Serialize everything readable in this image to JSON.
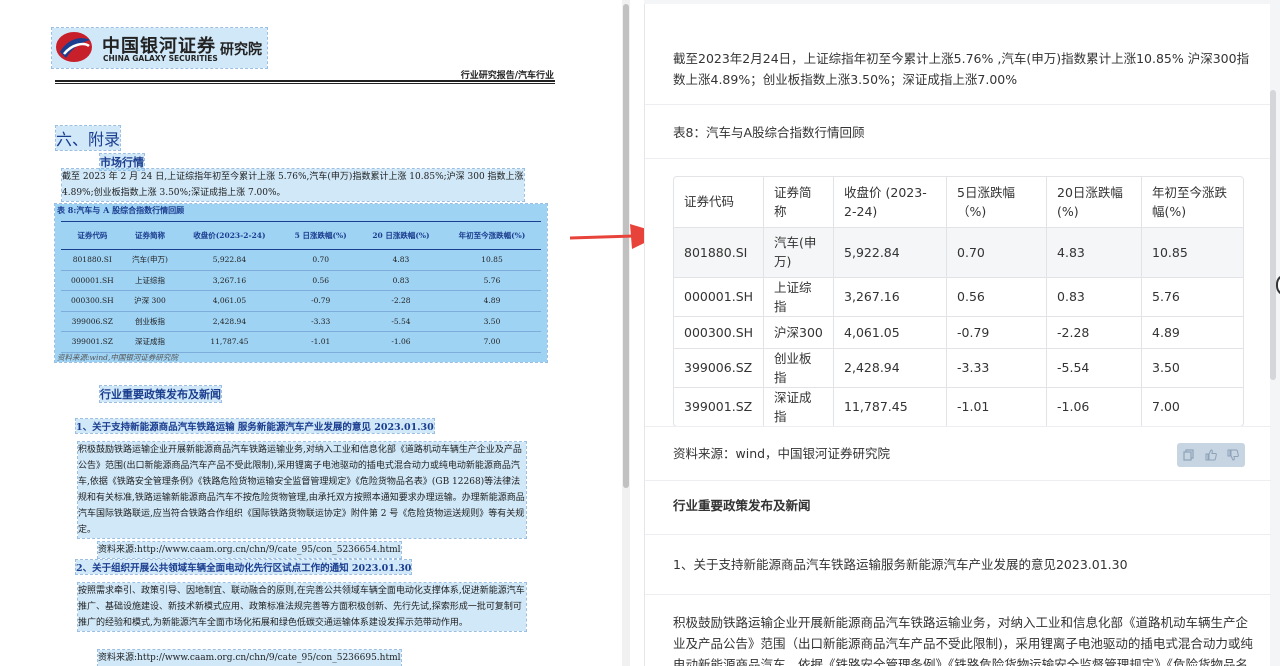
{
  "pdf": {
    "logo_cn": "中国银河证券",
    "logo_en": "CHINA GALAXY SECURITIES",
    "logo_inst": "研究院",
    "header_tag": "行业研究报告/汽车行业",
    "section_title": "六、附录",
    "market_heading": "市场行情",
    "market_paragraph": "截至 2023 年 2 月 24 日,上证综指年初至今累计上涨 5.76%,汽车(申万)指数累计上涨 10.85%;沪深 300 指数上涨 4.89%;创业板指数上涨 3.50%;深证成指上涨 7.00%。",
    "table_caption": "表 8:汽车与 A 股综合指数行情回顾",
    "table_headers": [
      "证券代码",
      "证券简称",
      "收盘价(2023-2-24)",
      "5 日涨跌幅(%)",
      "20 日涨跌幅(%)",
      "年初至今涨跌幅(%)"
    ],
    "table_rows": [
      [
        "801880.SI",
        "汽车(申万)",
        "5,922.84",
        "0.70",
        "4.83",
        "10.85"
      ],
      [
        "000001.SH",
        "上证综指",
        "3,267.16",
        "0.56",
        "0.83",
        "5.76"
      ],
      [
        "000300.SH",
        "沪深 300",
        "4,061.05",
        "-0.79",
        "-2.28",
        "4.89"
      ],
      [
        "399006.SZ",
        "创业板指",
        "2,428.94",
        "-3.33",
        "-5.54",
        "3.50"
      ],
      [
        "399001.SZ",
        "深证成指",
        "11,787.45",
        "-1.01",
        "-1.06",
        "7.00"
      ]
    ],
    "table_source": "资料来源:wind,中国银河证券研究院",
    "policy_heading": "行业重要政策发布及新闻",
    "news1_title": "1、关于支持新能源商品汽车铁路运输 服务新能源汽车产业发展的意见 2023.01.30",
    "news1_body": "积极鼓励铁路运输企业开展新能源商品汽车铁路运输业务,对纳入工业和信息化部《道路机动车辆生产企业及产品公告》范围(出口新能源商品汽车产品不受此限制),采用锂离子电池驱动的插电式混合动力或纯电动新能源商品汽车,依据《铁路安全管理条例》《铁路危险货物运输安全监督管理规定》《危险货物品名表》(GB 12268)等法律法规和有关标准,铁路运输新能源商品汽车不按危险货物管理,由承托双方按照本通知要求办理运输。办理新能源商品汽车国际铁路联运,应当符合铁路合作组织《国际铁路货物联运协定》附件第 2 号《危险货物运送规则》等有关规定。",
    "news1_source": "资料来源:http://www.caam.org.cn/chn/9/cate_95/con_5236654.html",
    "news2_title": "2、关于组织开展公共领域车辆全面电动化先行区试点工作的通知 2023.01.30",
    "news2_body": "按照需求牵引、政策引导、因地制宜、联动融合的原则,在完善公共领域车辆全面电动化支撑体系,促进新能源汽车推广、基础设施建设、新技术新模式应用、政策标准法规完善等方面积极创新、先行先试,探索形成一批可复制可推广的经验和模式,为新能源汽车全面市场化拓展和绿色低碳交通运输体系建设发挥示范带动作用。",
    "news2_source": "资料来源:http://www.caam.org.cn/chn/9/cate_95/con_5236695.html"
  },
  "chat": {
    "intro": "截至2023年2月24日，上证综指年初至今累计上涨5.76% ,汽车(申万)指数累计上涨10.85% 沪深300指数上涨4.89%；创业板指数上涨3.50%；深证成指上涨7.00%",
    "table_title": "表8：汽车与A股综合指数行情回顾",
    "headers": [
      "证券代码",
      "证券简称",
      "收盘价 (2023-2-24)",
      "5日涨跌幅（%)",
      "20日涨跌幅(%)",
      "年初至今涨跌幅(%)"
    ],
    "rows": [
      [
        "801880.SI",
        "汽车(申万)",
        "5,922.84",
        "0.70",
        "4.83",
        "10.85"
      ],
      [
        "000001.SH",
        "上证综指",
        "3,267.16",
        "0.56",
        "0.83",
        "5.76"
      ],
      [
        "000300.SH",
        "沪深300",
        "4,061.05",
        "-0.79",
        "-2.28",
        "4.89"
      ],
      [
        "399006.SZ",
        "创业板指",
        "2,428.94",
        "-3.33",
        "-5.54",
        "3.50"
      ],
      [
        "399001.SZ",
        "深证成指",
        "11,787.45",
        "-1.01",
        "-1.06",
        "7.00"
      ]
    ],
    "source": "资料来源：wind，中国银河证券研究院",
    "policy_heading": "行业重要政策发布及新闻",
    "news1_title": "1、关于支持新能源商品汽车铁路运输服务新能源汽车产业发展的意见2023.01.30",
    "news1_body": "积极鼓励铁路运输企业开展新能源商品汽车铁路运输业务，对纳入工业和信息化部《道路机动车辆生产企业及产品公告》范围（出口新能源商品汽车产品不受此限制)，采用锂离子电池驱动的插电式混合动力或纯电动新能源商品汽车，依据《铁路安全管理条例》《铁路危险货物运输安全监督管理规定》《危险货物品名表》"
  },
  "icons": {
    "feedback": [
      "copy-icon",
      "thumbs-up-icon",
      "thumbs-down-icon"
    ]
  },
  "colors": {
    "highlight": "#78bee8",
    "pdf_blue": "#1a3d8f",
    "arrow": "#e8433a",
    "logo_red": "#c8202b"
  }
}
